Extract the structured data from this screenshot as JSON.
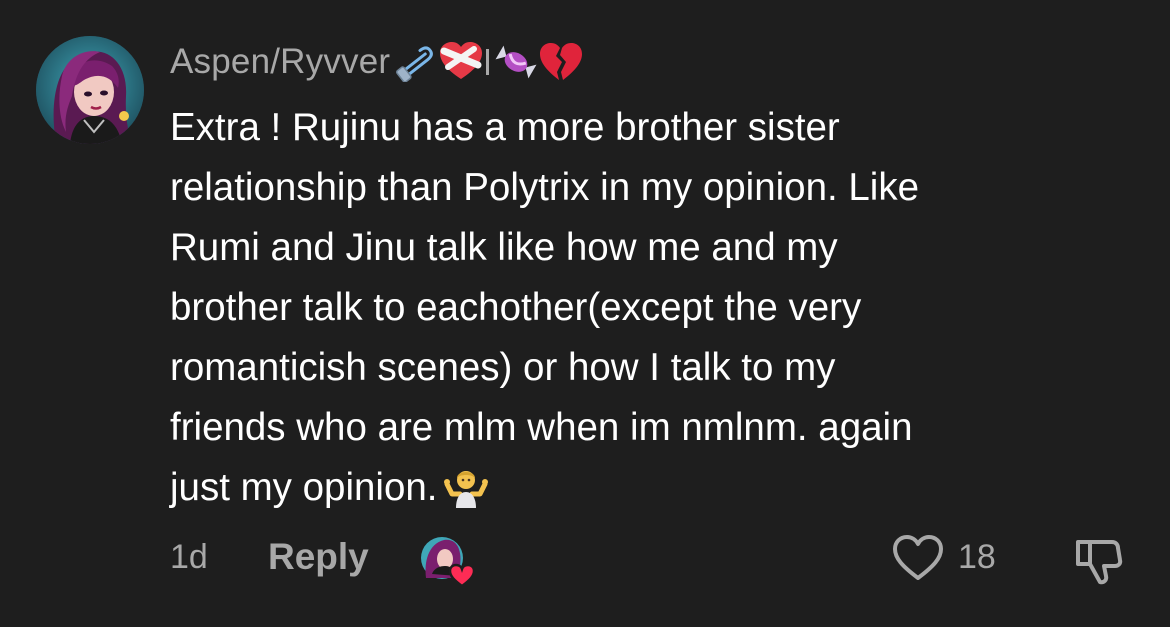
{
  "comment": {
    "username": "Aspen/Ryvver",
    "username_emojis": [
      "safety-pin",
      "mending-heart",
      "candy",
      "broken-heart"
    ],
    "body_lines": [
      "Extra ! Rujinu has a more brother sister",
      "relationship than Polytrix in my opinion. Like",
      "Rumi and Jinu talk like how me and my",
      "brother talk to eachother(except the very",
      "romanticish scenes) or how I talk to my",
      "friends who are mlm when im nmlnm. again",
      "just my opinion."
    ],
    "trailing_emoji": "person-shrugging",
    "timestamp": "1d",
    "reply_label": "Reply",
    "like_count": "18"
  },
  "colors": {
    "background": "#1e1e1e",
    "text_primary": "#ffffff",
    "text_secondary": "#a8a8a8",
    "heart_red": "#fe2c55"
  }
}
